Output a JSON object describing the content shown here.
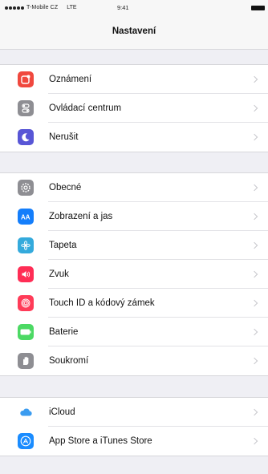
{
  "status_bar": {
    "carrier": "T-Mobile CZ",
    "network": "LTE",
    "time": "9:41"
  },
  "nav": {
    "title": "Nastavení"
  },
  "groups": [
    {
      "items": [
        {
          "label": "Oznámení",
          "icon": "notifications-icon",
          "color": "#f0483e"
        },
        {
          "label": "Ovládací centrum",
          "icon": "control-center-icon",
          "color": "#8e8e93"
        },
        {
          "label": "Nerušit",
          "icon": "moon-icon",
          "color": "#5856d6"
        }
      ]
    },
    {
      "items": [
        {
          "label": "Obecné",
          "icon": "gear-icon",
          "color": "#8e8e93"
        },
        {
          "label": "Zobrazení a jas",
          "icon": "display-brightness-icon",
          "color": "#147efb"
        },
        {
          "label": "Tapeta",
          "icon": "wallpaper-icon",
          "color": "#34aadc"
        },
        {
          "label": "Zvuk",
          "icon": "speaker-icon",
          "color": "#ff2d55"
        },
        {
          "label": "Touch ID a kódový zámek",
          "icon": "fingerprint-icon",
          "color": "#ff3b58"
        },
        {
          "label": "Baterie",
          "icon": "battery-icon",
          "color": "#4cd964"
        },
        {
          "label": "Soukromí",
          "icon": "hand-icon",
          "color": "#8e8e93"
        }
      ]
    },
    {
      "items": [
        {
          "label": "iCloud",
          "icon": "cloud-icon",
          "color": "#ffffff"
        },
        {
          "label": "App Store a iTunes Store",
          "icon": "app-store-icon",
          "color": "#1a8cff"
        }
      ]
    }
  ]
}
